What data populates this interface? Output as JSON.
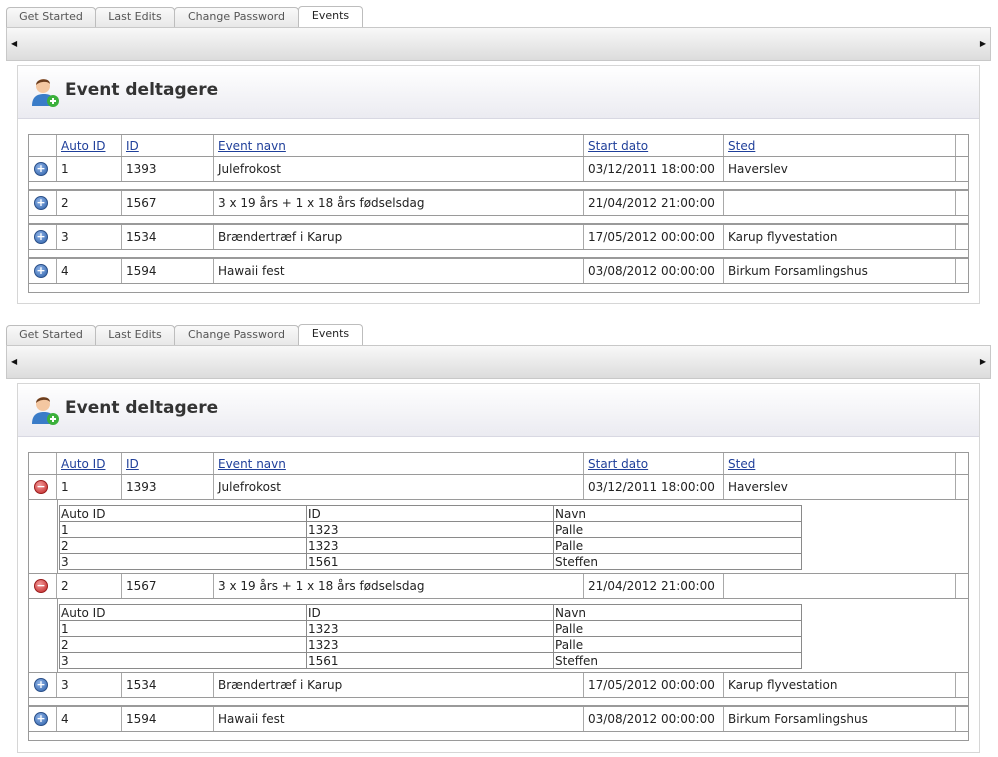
{
  "tabs": [
    "Get Started",
    "Last Edits",
    "Change Password",
    "Events"
  ],
  "active_tab": "Events",
  "page_title": "Event deltagere",
  "columns": [
    "Auto ID",
    "ID",
    "Event navn",
    "Start dato",
    "Sted"
  ],
  "events": [
    {
      "auto_id": "1",
      "id": "1393",
      "name": "Julefrokost",
      "start": "03/12/2011 18:00:00",
      "place": "Haverslev"
    },
    {
      "auto_id": "2",
      "id": "1567",
      "name": "3 x 19 års + 1 x 18 års fødselsdag",
      "start": "21/04/2012 21:00:00",
      "place": ""
    },
    {
      "auto_id": "3",
      "id": "1534",
      "name": "Brændertræf i Karup",
      "start": "17/05/2012 00:00:00",
      "place": "Karup flyvestation"
    },
    {
      "auto_id": "4",
      "id": "1594",
      "name": "Hawaii fest",
      "start": "03/08/2012 00:00:00",
      "place": "Birkum Forsamlingshus"
    }
  ],
  "subgrid": {
    "columns": [
      "Auto ID",
      "ID",
      "Navn"
    ],
    "event_1": [
      {
        "auto_id": "1",
        "id": "1323",
        "name": "Palle"
      },
      {
        "auto_id": "2",
        "id": "1323",
        "name": "Palle"
      },
      {
        "auto_id": "3",
        "id": "1561",
        "name": "Steffen"
      }
    ],
    "event_2": [
      {
        "auto_id": "1",
        "id": "1323",
        "name": "Palle"
      },
      {
        "auto_id": "2",
        "id": "1323",
        "name": "Palle"
      },
      {
        "auto_id": "3",
        "id": "1561",
        "name": "Steffen"
      }
    ]
  },
  "icons": {
    "expand": "plus-circle-icon",
    "collapse": "minus-circle-icon",
    "scroll_left": "arrow-left-icon",
    "scroll_right": "arrow-right-icon",
    "user_add": "user-add-icon"
  },
  "colors": {
    "link": "#1f3f9a",
    "expand": "#2c5fa8",
    "collapse": "#c02424"
  }
}
